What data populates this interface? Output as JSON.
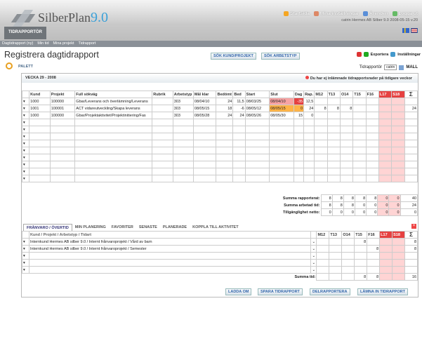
{
  "app": {
    "brand_name": "SilberPlan",
    "brand_version": "9.0",
    "module_tab": "TIDRAPPORTÖR"
  },
  "topnav": {
    "items": [
      {
        "label": "Startsida",
        "icon": "home-icon"
      },
      {
        "label": "Mina inställningar",
        "icon": "settings-icon"
      },
      {
        "label": "Ärenden",
        "icon": "cases-icon"
      },
      {
        "label": "Logga ut",
        "icon": "logout-icon"
      }
    ],
    "user_info": "catrin  Hermes AB Silber 9.0  2008-05-15  v.20"
  },
  "subnav": [
    "Dagtidrapport (ny)",
    "Min tid",
    "Mina projekt",
    "Tidrapport"
  ],
  "page": {
    "title": "Registrera dagtidrapport",
    "search_project_btn": "SÖK KUND/PROJEKT",
    "search_worktype_btn": "SÖK ARBETSTYP",
    "export_label": "Exportera",
    "settings_label": "Inställningar",
    "palett_label": "PALETT",
    "reporter_label": "Tidrapportör",
    "reporter_value": "catrin",
    "template_label": "MALL"
  },
  "week": {
    "label": "VECKA 29 - 2008",
    "warning": "Du har ej inlämnade tidrapportsrader på tidigare veckor"
  },
  "grid": {
    "headers": [
      "Kund",
      "Projekt",
      "Full sökväg",
      "Rubrik",
      "Arbetstyp",
      "Mål klar",
      "Bedömt",
      "Bed",
      "Start",
      "Slut",
      "Dag",
      "Rap.",
      "M12",
      "T13",
      "O14",
      "T15",
      "F16",
      "L17",
      "S18",
      "Σ"
    ],
    "rows": [
      [
        "1000",
        "100000",
        "Gbar/Leverans och överlämning/Leverans",
        "",
        "303",
        "08/04/10",
        "24",
        "11,5",
        "08/03/25",
        "08/04/10",
        "-35",
        "12,5",
        "",
        "",
        "",
        "",
        "",
        "",
        "",
        ""
      ],
      [
        "1001",
        "100001",
        "ACT vidareutveckling/Skapa leverans",
        "",
        "303",
        "08/05/15",
        "18",
        "-6",
        "08/05/12",
        "08/05/15",
        "0",
        "24",
        "8",
        "8",
        "8",
        "",
        "",
        "",
        "",
        "24"
      ],
      [
        "1000",
        "100000",
        "Gbar/Projektaktivitet/Projektinitiering/Fas",
        "",
        "303",
        "08/05/28",
        "24",
        "24",
        "08/05/26",
        "08/05/30",
        "15",
        "0",
        "",
        "",
        "",
        "",
        "",
        "",
        "",
        ""
      ]
    ],
    "sums": [
      {
        "label": "Summa rapporterat:",
        "values": [
          "8",
          "8",
          "8",
          "8",
          "8",
          "0",
          "0",
          "40"
        ]
      },
      {
        "label": "Summa arbetad tid:",
        "values": [
          "8",
          "8",
          "8",
          "0",
          "0",
          "0",
          "0",
          "24"
        ]
      },
      {
        "label": "Tillgänglighet netto:",
        "values": [
          "0",
          "0",
          "0",
          "0",
          "0",
          "0",
          "0",
          "0"
        ]
      }
    ]
  },
  "tabs": [
    "FRÅNVARO / ÖVERTID",
    "MIN PLANERING",
    "FAVORITER",
    "SENASTE",
    "PLANERADE",
    "KOPPLA TILL AKTIVITET"
  ],
  "absence": {
    "headers": [
      "Kund / Projekt / Arbetstyp / Tidart",
      "M12",
      "T13",
      "O14",
      "T15",
      "F16",
      "L17",
      "S18",
      "Σ"
    ],
    "rows": [
      {
        "text": "Internkund Hermes AB silber 9.0 / Internt frånvaroprojekt / Vård av barn",
        "values": [
          "",
          "",
          "",
          "8",
          "",
          "",
          "",
          "8"
        ]
      },
      {
        "text": "Internkund Hermes AB silber 9.0 / Internt frånvaroprojekt / Semester",
        "values": [
          "",
          "",
          "",
          "",
          "8",
          "",
          "",
          "8"
        ]
      }
    ],
    "sum_label": "Summa tid:",
    "sum_values": [
      "",
      "",
      "",
      "8",
      "8",
      "",
      "",
      "16"
    ]
  },
  "buttons": [
    "LADDA OM",
    "SPARA TIDRAPPORT",
    "DELRAPPORTERA",
    "LÄMNA IN TIDRAPPORT"
  ]
}
